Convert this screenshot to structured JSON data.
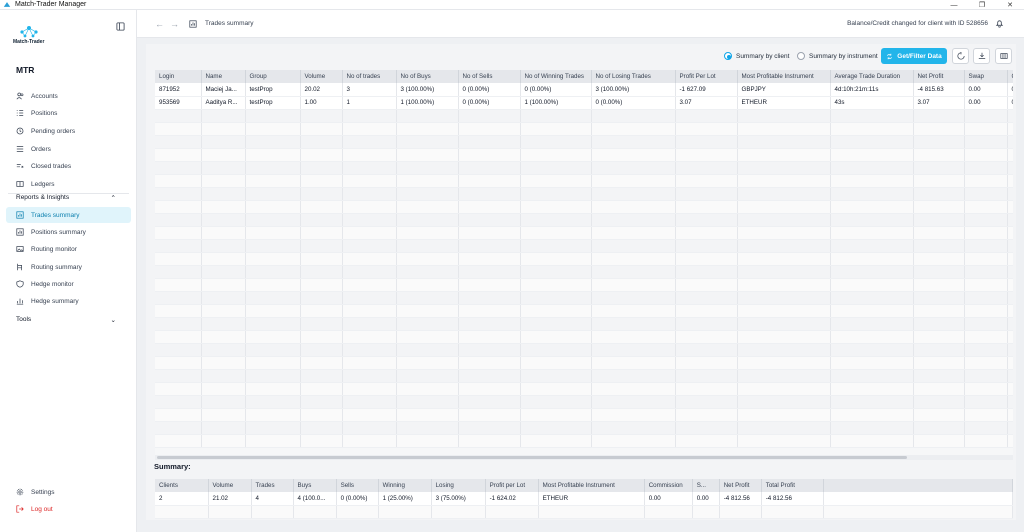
{
  "window": {
    "title": "Match-Trader Manager",
    "controls": [
      "—",
      "❐",
      "✕"
    ]
  },
  "sidebar": {
    "logo_text": "Match-Trader",
    "org_name": "MTR",
    "items": [
      {
        "label": "Accounts",
        "icon": "users-icon"
      },
      {
        "label": "Positions",
        "icon": "list-icon"
      },
      {
        "label": "Pending orders",
        "icon": "clock-icon"
      },
      {
        "label": "Orders",
        "icon": "lines-icon"
      },
      {
        "label": "Closed trades",
        "icon": "closed-trades-icon"
      },
      {
        "label": "Ledgers",
        "icon": "ledger-icon"
      }
    ],
    "reports_section": "Reports & Insights",
    "reports_items": [
      {
        "label": "Trades summary",
        "icon": "table-icon",
        "active": true
      },
      {
        "label": "Positions summary",
        "icon": "table-icon"
      },
      {
        "label": "Routing monitor",
        "icon": "image-icon"
      },
      {
        "label": "Routing summary",
        "icon": "routing-icon"
      },
      {
        "label": "Hedge monitor",
        "icon": "shield-icon"
      },
      {
        "label": "Hedge summary",
        "icon": "chart-icon"
      }
    ],
    "tools_section": "Tools",
    "settings": "Settings",
    "logout": "Log out"
  },
  "topbar": {
    "page_title": "Trades summary",
    "notification": "Balance/Credit changed for client with ID 528656"
  },
  "toolbar": {
    "radio_client": "Summary by client",
    "radio_instrument": "Summary by instrument",
    "selected": "client",
    "get_filter": "Get/Filter Data"
  },
  "colors": {
    "accent": "#22b5ea",
    "active_bg": "#e0f4fb",
    "active_text": "#0b7fae",
    "logout": "#dc2626"
  },
  "main_table": {
    "columns": [
      "Login",
      "Name",
      "Group",
      "Volume",
      "No of trades",
      "No of Buys",
      "No of Sells",
      "No of Winning Trades",
      "No of Losing Trades",
      "Profit Per Lot",
      "Most Profitable Instrument",
      "Average Trade Duration",
      "Net Profit",
      "Swap",
      "C"
    ],
    "rows": [
      [
        "871952",
        "Maciej Ja...",
        "testProp",
        "20.02",
        "3",
        "3 (100.00%)",
        "0 (0.00%)",
        "0 (0.00%)",
        "3 (100.00%)",
        "-1 627.09",
        "GBPJPY",
        "4d:10h:21m:11s",
        "-4 815.63",
        "0.00",
        "0"
      ],
      [
        "953569",
        "Aaditya R...",
        "testProp",
        "1.00",
        "1",
        "1 (100.00%)",
        "0 (0.00%)",
        "1 (100.00%)",
        "0 (0.00%)",
        "3.07",
        "ETHEUR",
        "43s",
        "3.07",
        "0.00",
        "0"
      ]
    ]
  },
  "summary": {
    "label": "Summary:",
    "columns": [
      "Clients",
      "Volume",
      "Trades",
      "Buys",
      "Sells",
      "Winning",
      "Losing",
      "Profit per Lot",
      "Most Profitable Instrument",
      "Commission",
      "S...",
      "Net Profit",
      "Total Profit"
    ],
    "row": [
      "2",
      "21.02",
      "4",
      "4 (100.0...",
      "0 (0.00%)",
      "1 (25.00%)",
      "3 (75.00%)",
      "-1 624.02",
      "ETHEUR",
      "0.00",
      "0.00",
      "-4 812.56",
      "-4 812.56"
    ]
  }
}
